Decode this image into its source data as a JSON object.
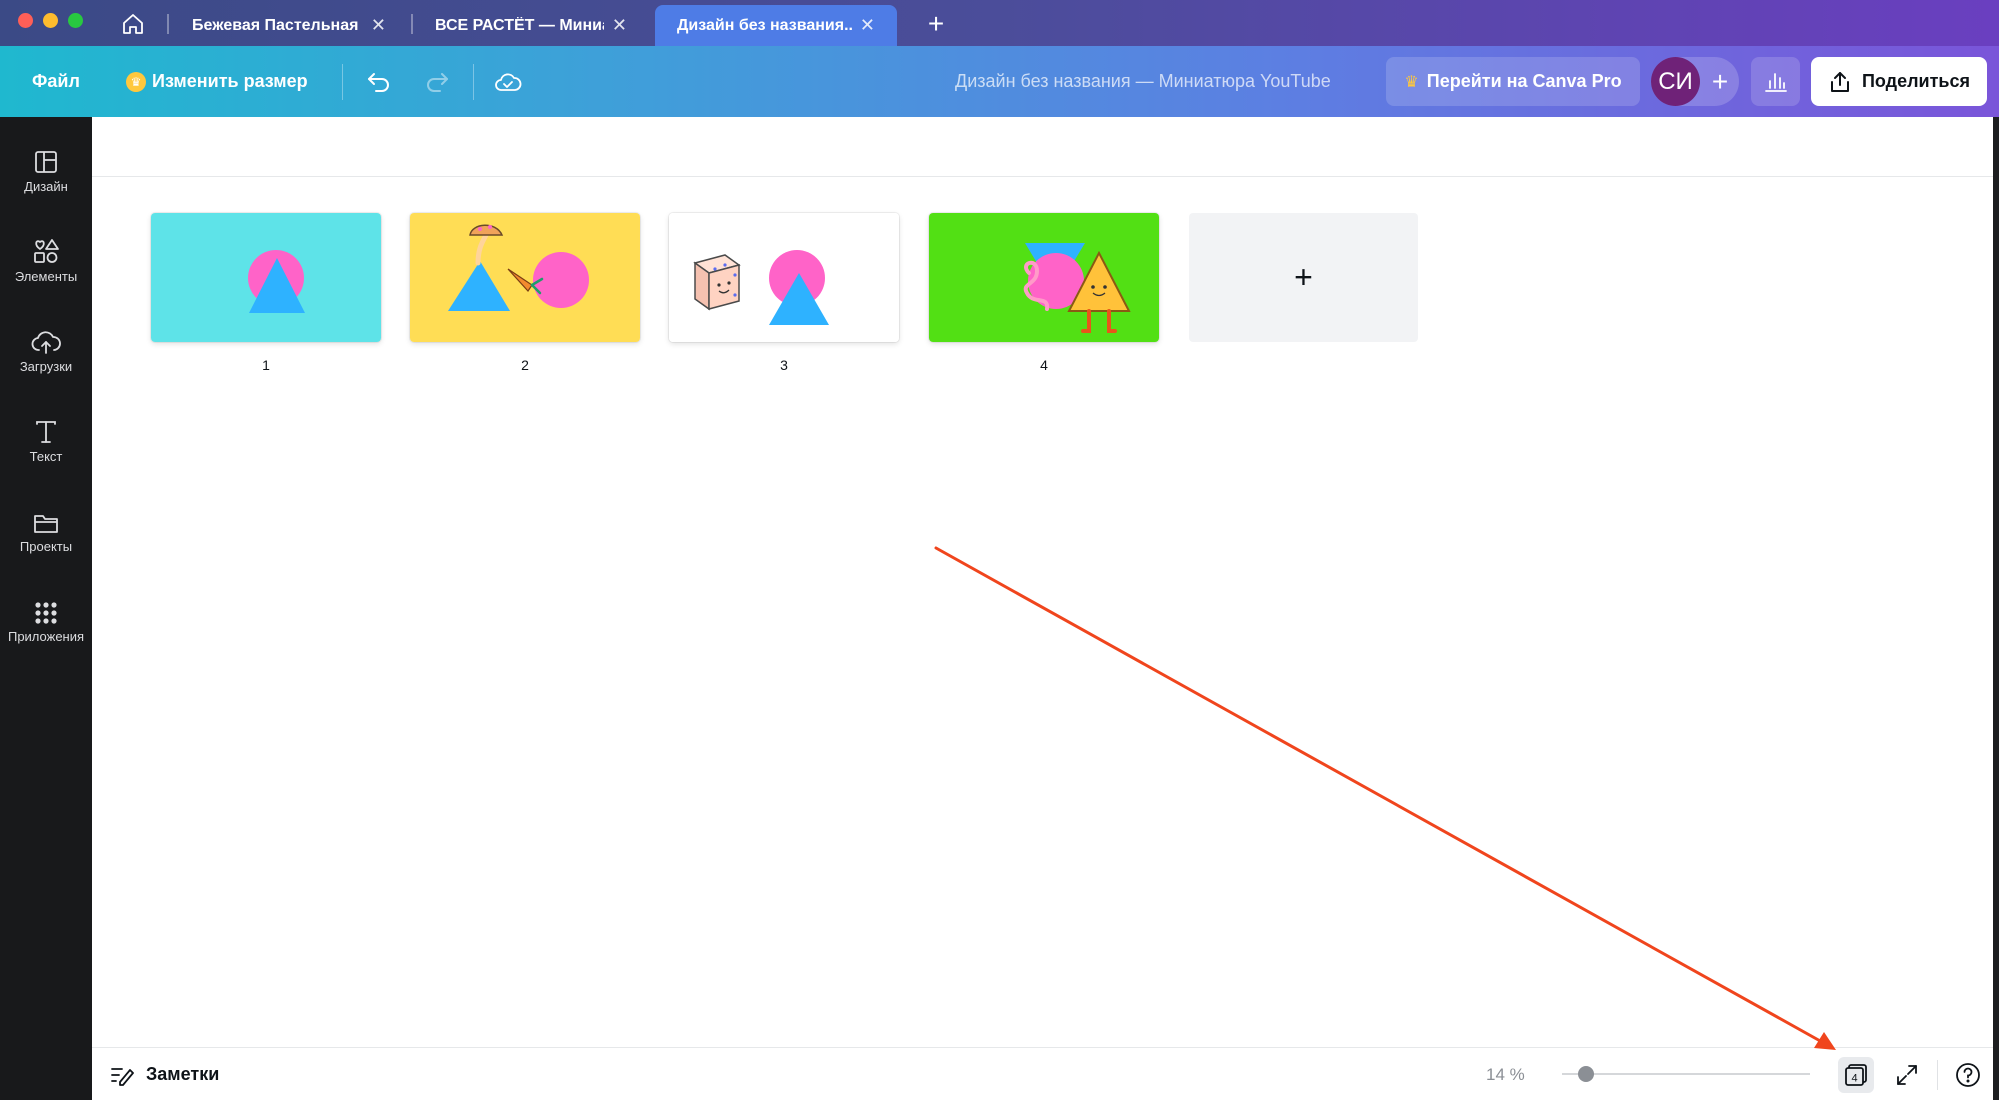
{
  "window": {
    "tabs": [
      {
        "title": "Бежевая Пастельная ...",
        "active": false
      },
      {
        "title": "ВСЕ РАСТЁТ — Миниа...",
        "active": false
      },
      {
        "title": "Дизайн без названия...",
        "active": true
      }
    ],
    "icons": {
      "home": "home-icon",
      "new_tab": "plus-icon",
      "close": "close-icon"
    }
  },
  "toolbar": {
    "file_label": "Файл",
    "resize_label": "Изменить размер",
    "doc_title": "Дизайн без названия — Миниатюра YouTube",
    "pro_label": "Перейти на Canva Pro",
    "avatar_initials": "СИ",
    "share_label": "Поделиться",
    "icons": [
      "undo-icon",
      "redo-icon",
      "cloud-saved-icon",
      "crown-icon",
      "stats-icon",
      "share-icon"
    ]
  },
  "sidebar": {
    "items": [
      {
        "label": "Дизайн",
        "icon": "layout-icon"
      },
      {
        "label": "Элементы",
        "icon": "shapes-icon"
      },
      {
        "label": "Загрузки",
        "icon": "cloud-upload-icon"
      },
      {
        "label": "Текст",
        "icon": "text-icon"
      },
      {
        "label": "Проекты",
        "icon": "folder-icon"
      },
      {
        "label": "Приложения",
        "icon": "apps-grid-icon"
      }
    ]
  },
  "pages": [
    {
      "number": "1",
      "background": "#5ee3e8"
    },
    {
      "number": "2",
      "background": "#ffdd55"
    },
    {
      "number": "3",
      "background": "#ffffff"
    },
    {
      "number": "4",
      "background": "#52e014"
    }
  ],
  "add_page_label": "+",
  "bottom_bar": {
    "notes_label": "Заметки",
    "zoom_label": "14 %",
    "zoom_value_percent": 14,
    "page_count": "4"
  },
  "colors": {
    "accent_pink": "#ff63c8",
    "accent_blue": "#2eb2ff",
    "annotation_arrow": "#f0451d",
    "sidebar_bg": "#18191b"
  }
}
